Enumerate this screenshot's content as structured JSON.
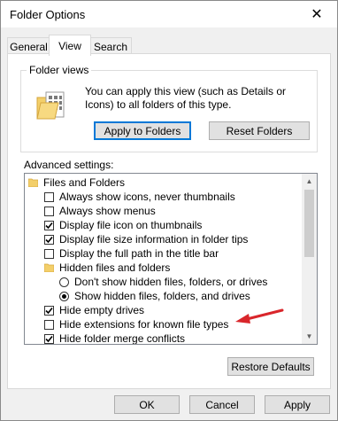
{
  "window": {
    "title": "Folder Options",
    "close_glyph": "✕"
  },
  "tabs": [
    {
      "label": "General",
      "active": false
    },
    {
      "label": "View",
      "active": true
    },
    {
      "label": "Search",
      "active": false
    }
  ],
  "folder_views": {
    "legend": "Folder views",
    "description": "You can apply this view (such as Details or Icons) to all folders of this type.",
    "apply_button": "Apply to Folders",
    "reset_button": "Reset Folders"
  },
  "advanced": {
    "label": "Advanced settings:",
    "items": [
      {
        "type": "folder",
        "label": "Files and Folders"
      },
      {
        "type": "checkbox",
        "checked": false,
        "label": "Always show icons, never thumbnails"
      },
      {
        "type": "checkbox",
        "checked": false,
        "label": "Always show menus"
      },
      {
        "type": "checkbox",
        "checked": true,
        "label": "Display file icon on thumbnails"
      },
      {
        "type": "checkbox",
        "checked": true,
        "label": "Display file size information in folder tips"
      },
      {
        "type": "checkbox",
        "checked": false,
        "label": "Display the full path in the title bar"
      },
      {
        "type": "subfolder",
        "label": "Hidden files and folders"
      },
      {
        "type": "radio",
        "checked": false,
        "label": "Don't show hidden files, folders, or drives"
      },
      {
        "type": "radio",
        "checked": true,
        "label": "Show hidden files, folders, and drives"
      },
      {
        "type": "checkbox",
        "checked": true,
        "label": "Hide empty drives"
      },
      {
        "type": "checkbox",
        "checked": false,
        "label": "Hide extensions for known file types"
      },
      {
        "type": "checkbox",
        "checked": true,
        "label": "Hide folder merge conflicts"
      }
    ],
    "restore_button": "Restore Defaults"
  },
  "footer": {
    "ok": "OK",
    "cancel": "Cancel",
    "apply": "Apply"
  },
  "colors": {
    "annotation_arrow": "#d9262b",
    "focus_border": "#0078d7",
    "folder_yellow": "#f3cf6a"
  }
}
